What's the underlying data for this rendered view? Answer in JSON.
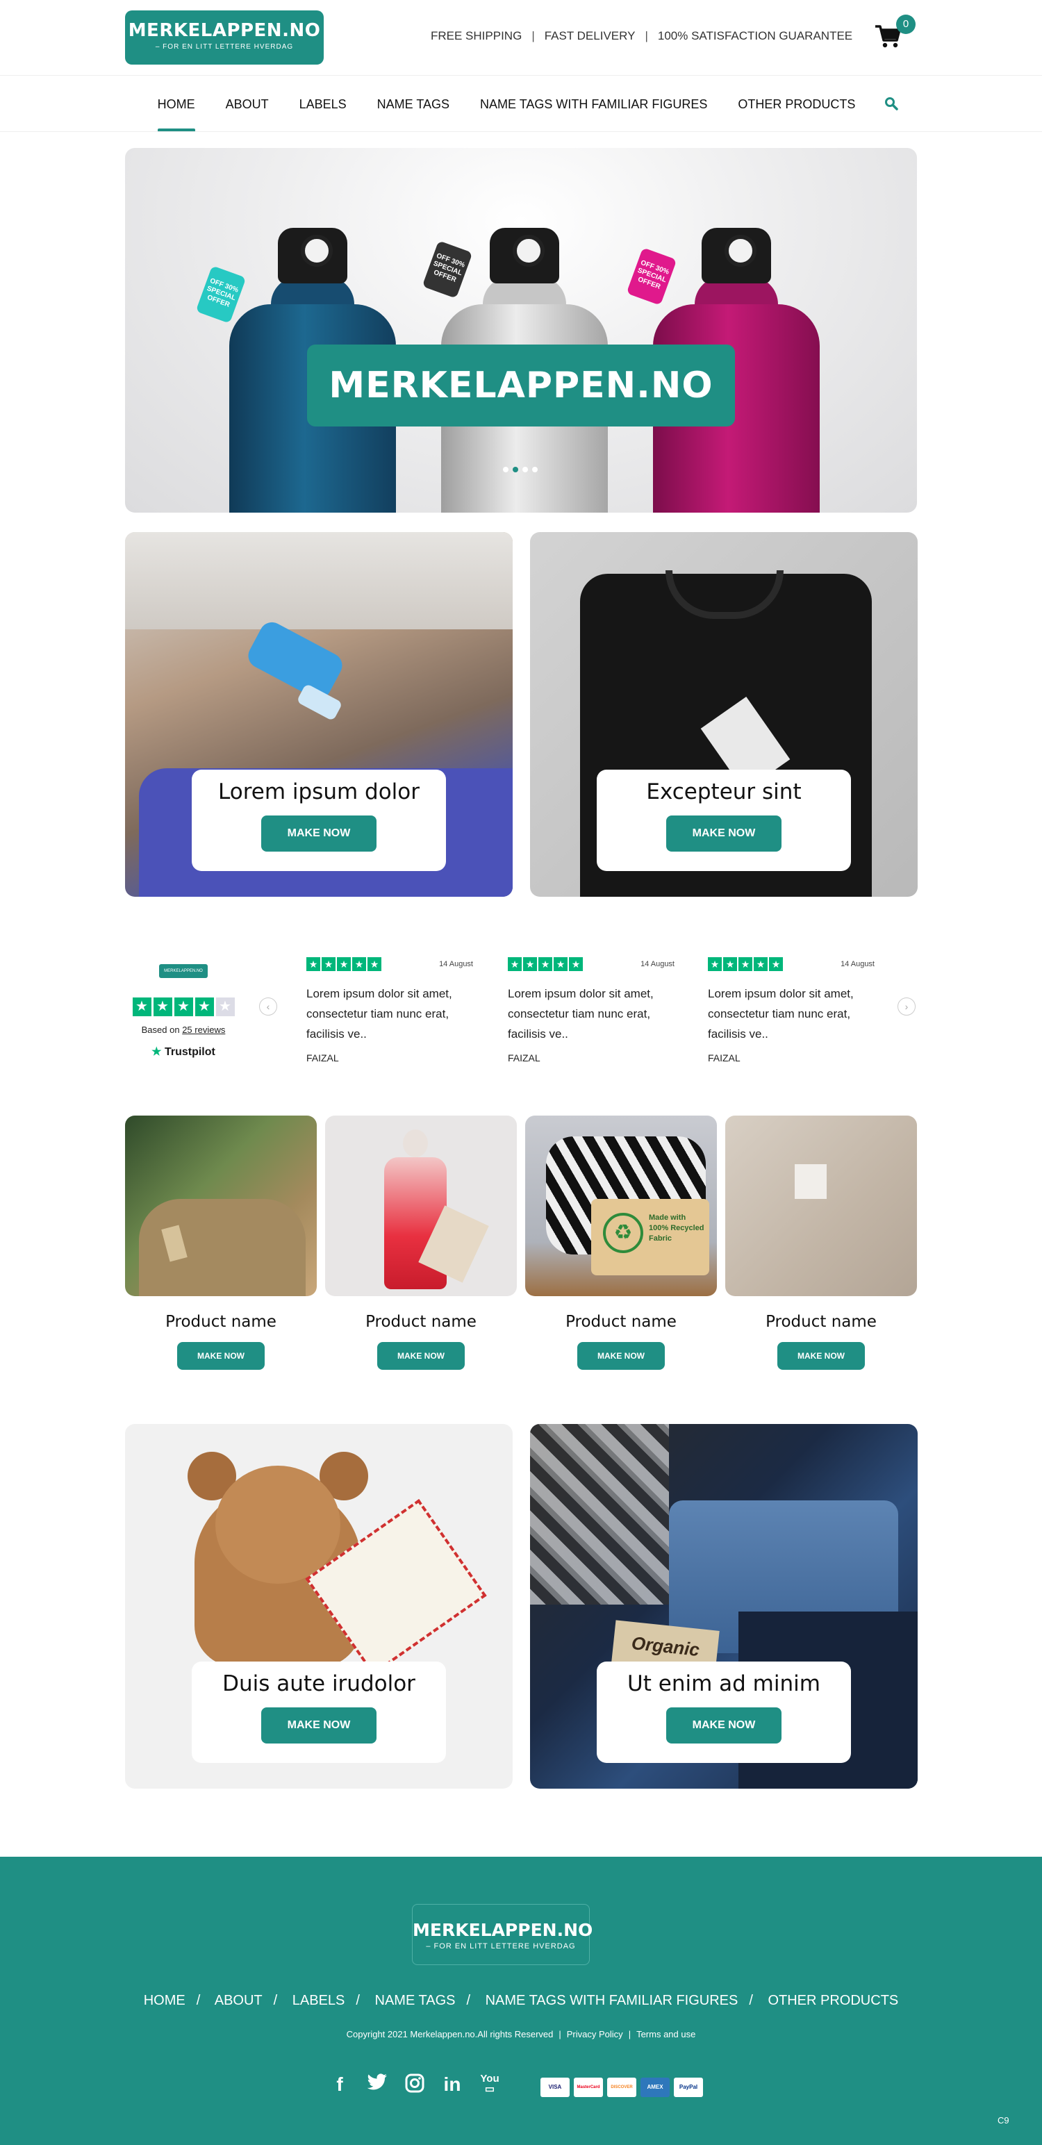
{
  "header": {
    "logo_title": "MERKELAPPEN.NO",
    "logo_tagline": "– FOR EN LITT LETTERE HVERDAG",
    "topbar": [
      "FREE SHIPPING",
      "FAST DELIVERY",
      "100% SATISFACTION GUARANTEE"
    ],
    "cart_count": "0",
    "icons": {
      "cart": "cart-icon",
      "search": "search-icon"
    }
  },
  "nav": {
    "items": [
      {
        "label": "HOME",
        "active": true
      },
      {
        "label": "ABOUT",
        "active": false
      },
      {
        "label": "LABELS",
        "active": false
      },
      {
        "label": "NAME TAGS",
        "active": false
      },
      {
        "label": "NAME TAGS WITH FAMILIAR FIGURES",
        "active": false
      },
      {
        "label": "OTHER PRODUCTS",
        "active": false
      }
    ]
  },
  "hero": {
    "title": "MERKELAPPEN.NO",
    "tag_text": "OFF 30% SPECIAL OFFER",
    "slides": 4,
    "active_slide": 2
  },
  "promo_top": [
    {
      "title": "Lorem ipsum dolor",
      "button": "MAKE NOW"
    },
    {
      "title": "Excepteur sint",
      "button": "MAKE NOW"
    }
  ],
  "trustpilot": {
    "logo_text": "MERKELAPPEN.NO",
    "rating_stars": 4,
    "based_on_prefix": "Based on",
    "reviews_link": "25 reviews",
    "brand": "Trustpilot"
  },
  "reviews": [
    {
      "date": "14 August",
      "text": "Lorem ipsum dolor sit amet, consectetur tiam nunc erat, facilisis ve..",
      "author": "FAIZAL"
    },
    {
      "date": "14 August",
      "text": "Lorem ipsum dolor sit amet, consectetur tiam nunc erat, facilisis ve..",
      "author": "FAIZAL"
    },
    {
      "date": "14 August",
      "text": "Lorem ipsum dolor sit amet, consectetur tiam nunc erat, facilisis ve..",
      "author": "FAIZAL"
    }
  ],
  "products": [
    {
      "name": "Product name",
      "button": "MAKE NOW"
    },
    {
      "name": "Product name",
      "button": "MAKE NOW"
    },
    {
      "name": "Product name",
      "button": "MAKE NOW"
    },
    {
      "name": "Product name",
      "button": "MAKE NOW"
    }
  ],
  "product_tag_text": "Made with 100% Recycled Fabric",
  "organic_tag_text": "Organic",
  "promo_bottom": [
    {
      "title": "Duis aute irudolor",
      "button": "MAKE NOW"
    },
    {
      "title": "Ut enim ad minim",
      "button": "MAKE NOW"
    }
  ],
  "footer": {
    "logo_title": "MERKELAPPEN.NO",
    "logo_tagline": "– FOR EN LITT LETTERE HVERDAG",
    "nav": [
      "HOME",
      "ABOUT",
      "LABELS",
      "NAME TAGS",
      "NAME TAGS WITH FAMILIAR FIGURES",
      "OTHER PRODUCTS"
    ],
    "copyright": "Copyright 2021 Merkelappen.no.All rights Reserved",
    "privacy": "Privacy Policy",
    "terms": "Terms and use",
    "social": [
      "facebook-icon",
      "twitter-icon",
      "instagram-icon",
      "linkedin-icon",
      "youtube-icon"
    ],
    "payments": [
      "VISA",
      "MasterCard",
      "DISCOVER",
      "AMEX",
      "PayPal"
    ],
    "corner": "C9"
  },
  "colors": {
    "brand": "#1f8f84",
    "trustpilot": "#00b67a"
  }
}
